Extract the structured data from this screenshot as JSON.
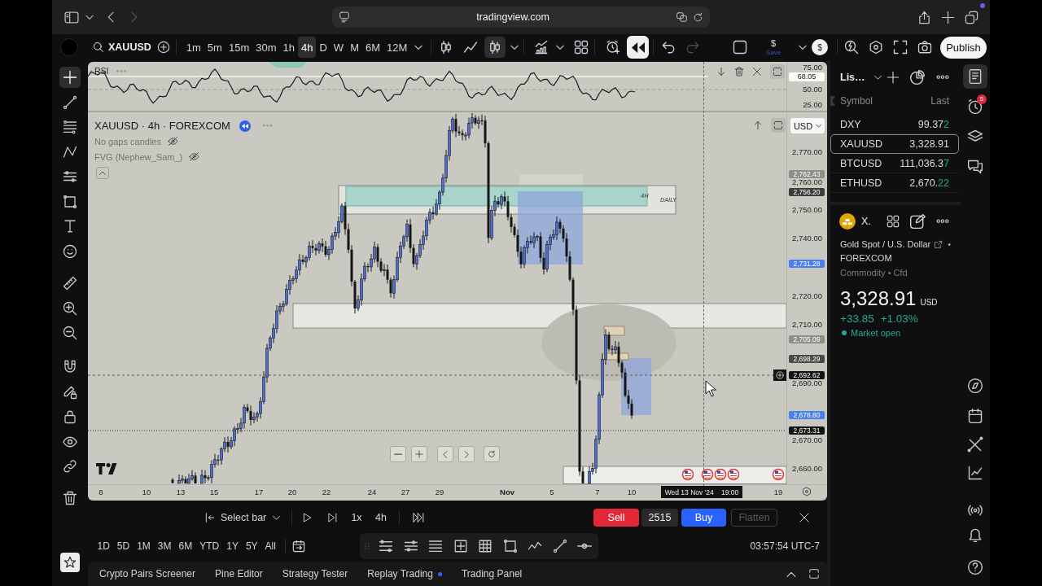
{
  "browser": {
    "url": "tradingview.com",
    "back_disabled": false,
    "forward_disabled": true
  },
  "toolbar": {
    "symbol": "XAUUSD",
    "intervals": [
      {
        "label": "1m",
        "selected": false
      },
      {
        "label": "5m",
        "selected": false
      },
      {
        "label": "15m",
        "selected": false
      },
      {
        "label": "30m",
        "selected": false
      },
      {
        "label": "1h",
        "selected": false
      },
      {
        "label": "4h",
        "selected": true
      },
      {
        "label": "D",
        "selected": false
      },
      {
        "label": "W",
        "selected": false
      },
      {
        "label": "M",
        "selected": false
      },
      {
        "label": "6M",
        "selected": false
      },
      {
        "label": "12M",
        "selected": false
      }
    ],
    "chart_types": [
      {
        "kind": "bars",
        "selected": false
      },
      {
        "kind": "line",
        "selected": false
      },
      {
        "kind": "candles",
        "selected": true
      }
    ],
    "replay_on": true,
    "undo_disabled": false,
    "redo_disabled": true,
    "save_icon": "$",
    "save_label": "Save",
    "currency_badge": "$",
    "publish": "Publish"
  },
  "left_tools": [
    {
      "kind": "crosshair",
      "selected": true
    },
    {
      "kind": "trend_line",
      "selected": false
    },
    {
      "kind": "fib",
      "selected": false
    },
    {
      "kind": "pattern",
      "selected": false
    },
    {
      "kind": "channel",
      "selected": false
    },
    {
      "kind": "rectangle",
      "selected": false
    },
    {
      "kind": "text",
      "selected": false
    },
    {
      "kind": "emoji",
      "selected": false
    },
    {
      "kind": "ruler",
      "selected": false
    },
    {
      "kind": "zoom_in",
      "selected": false
    },
    {
      "kind": "zoom_out",
      "selected": false
    },
    {
      "kind": "magnet",
      "selected": false
    },
    {
      "kind": "stay_drawing",
      "selected": false
    },
    {
      "kind": "lock",
      "selected": false
    },
    {
      "kind": "hide",
      "selected": false
    },
    {
      "kind": "sync",
      "selected": false
    },
    {
      "kind": "remove",
      "selected": false
    }
  ],
  "favorites": {
    "on": true
  },
  "rsi": {
    "label": "RSI",
    "scale": [
      "75.00",
      "50.00",
      "25.00"
    ],
    "value": "68.05"
  },
  "legend": {
    "title": "XAUUSD · 4h · FOREXCOM",
    "indicators": [
      {
        "name": "No gaps candles",
        "hidden": true
      },
      {
        "name": "FVG (Nephew_Sam_)",
        "hidden": true
      }
    ]
  },
  "currency": "USD",
  "zones": [
    {
      "label": "4H"
    },
    {
      "label": "DAILY"
    }
  ],
  "price_scale": [
    "2,770.00",
    "2,760.00",
    "2,750.00",
    "2,740.00",
    "2,720.00",
    "2,710.00",
    "2,690.00",
    "2,670.00",
    "2,660.00"
  ],
  "price_markers": [
    {
      "value": "2,762.43",
      "color": "#8e8e8a"
    },
    {
      "value": "2,756.20",
      "color": "#3c3c3c"
    },
    {
      "value": "2,731.28",
      "color": "#4a7ff0"
    },
    {
      "value": "2,705.09",
      "color": "#8e8e8a"
    },
    {
      "value": "2,698.29",
      "color": "#4a4a4a"
    },
    {
      "value": "2,678.80",
      "color": "#4a7ff0"
    },
    {
      "value": "2,673.31",
      "color": "#131313"
    }
  ],
  "crosshair": {
    "price": "2,692.62",
    "date": "Wed 13 Nov '24",
    "time": "19:00"
  },
  "time_scale": [
    {
      "label": "8",
      "kind": "day"
    },
    {
      "label": "10",
      "kind": "day"
    },
    {
      "label": "13",
      "kind": "day"
    },
    {
      "label": "15",
      "kind": "day"
    },
    {
      "label": "17",
      "kind": "day"
    },
    {
      "label": "20",
      "kind": "day"
    },
    {
      "label": "22",
      "kind": "day"
    },
    {
      "label": "24",
      "kind": "day"
    },
    {
      "label": "27",
      "kind": "day"
    },
    {
      "label": "29",
      "kind": "day"
    },
    {
      "label": "Nov",
      "kind": "month"
    },
    {
      "label": "5",
      "kind": "day"
    },
    {
      "label": "7",
      "kind": "day"
    },
    {
      "label": "10",
      "kind": "day"
    },
    {
      "label": "19",
      "kind": "day"
    }
  ],
  "watchlist": {
    "title": "Lis…",
    "col_symbol": "Symbol",
    "col_last": "Last",
    "rows": [
      {
        "symbol": "DXY",
        "last": "99.37",
        "last_tick": "2",
        "selected": false
      },
      {
        "symbol": "XAUUSD",
        "last": "3,328.91",
        "selected": true
      },
      {
        "symbol": "BTCUSD",
        "last": "111,036.3",
        "last_tick": "7",
        "selected": false
      },
      {
        "symbol": "ETHUSD",
        "last": "2,670.",
        "last_tick": "22",
        "selected": false
      }
    ]
  },
  "details": {
    "short_name": "X.",
    "description": "Gold Spot / U.S. Dollar",
    "separator": "•",
    "exchange": "FOREXCOM",
    "type": "Commodity • Cfd",
    "price": "3,328.91",
    "currency": "USD",
    "change": "+33.85",
    "change_pct": "+1.03%",
    "status": "Market open",
    "market_open": true
  },
  "side_icons": [
    {
      "kind": "watchlist",
      "selected": true
    },
    {
      "kind": "alerts",
      "selected": false,
      "badge": "5"
    },
    {
      "kind": "object_tree",
      "selected": false
    },
    {
      "kind": "chats",
      "selected": false
    },
    {
      "kind": "screener",
      "selected": false
    },
    {
      "kind": "calendar",
      "selected": false
    },
    {
      "kind": "lines",
      "selected": false
    },
    {
      "kind": "chart",
      "selected": false
    },
    {
      "kind": "streams",
      "selected": false
    },
    {
      "kind": "notifications",
      "selected": false
    },
    {
      "kind": "help",
      "selected": false
    }
  ],
  "replay": {
    "select_bar": "Select bar",
    "speed": "1x",
    "interval": "4h",
    "sell": "Sell",
    "quantity": "2515",
    "buy": "Buy",
    "flatten": "Flatten",
    "flatten_disabled": true
  },
  "ranges": [
    "1D",
    "5D",
    "1M",
    "3M",
    "6M",
    "YTD",
    "1Y",
    "5Y",
    "All"
  ],
  "clock": "03:57:54 UTC-7",
  "bottom_tabs": [
    {
      "label": "Crypto Pairs Screener",
      "selected": false,
      "dot": false
    },
    {
      "label": "Pine Editor",
      "selected": false,
      "dot": false
    },
    {
      "label": "Strategy Tester",
      "selected": false,
      "dot": false
    },
    {
      "label": "Replay Trading",
      "selected": false,
      "dot": true
    },
    {
      "label": "Trading Panel",
      "selected": false,
      "dot": false
    }
  ]
}
